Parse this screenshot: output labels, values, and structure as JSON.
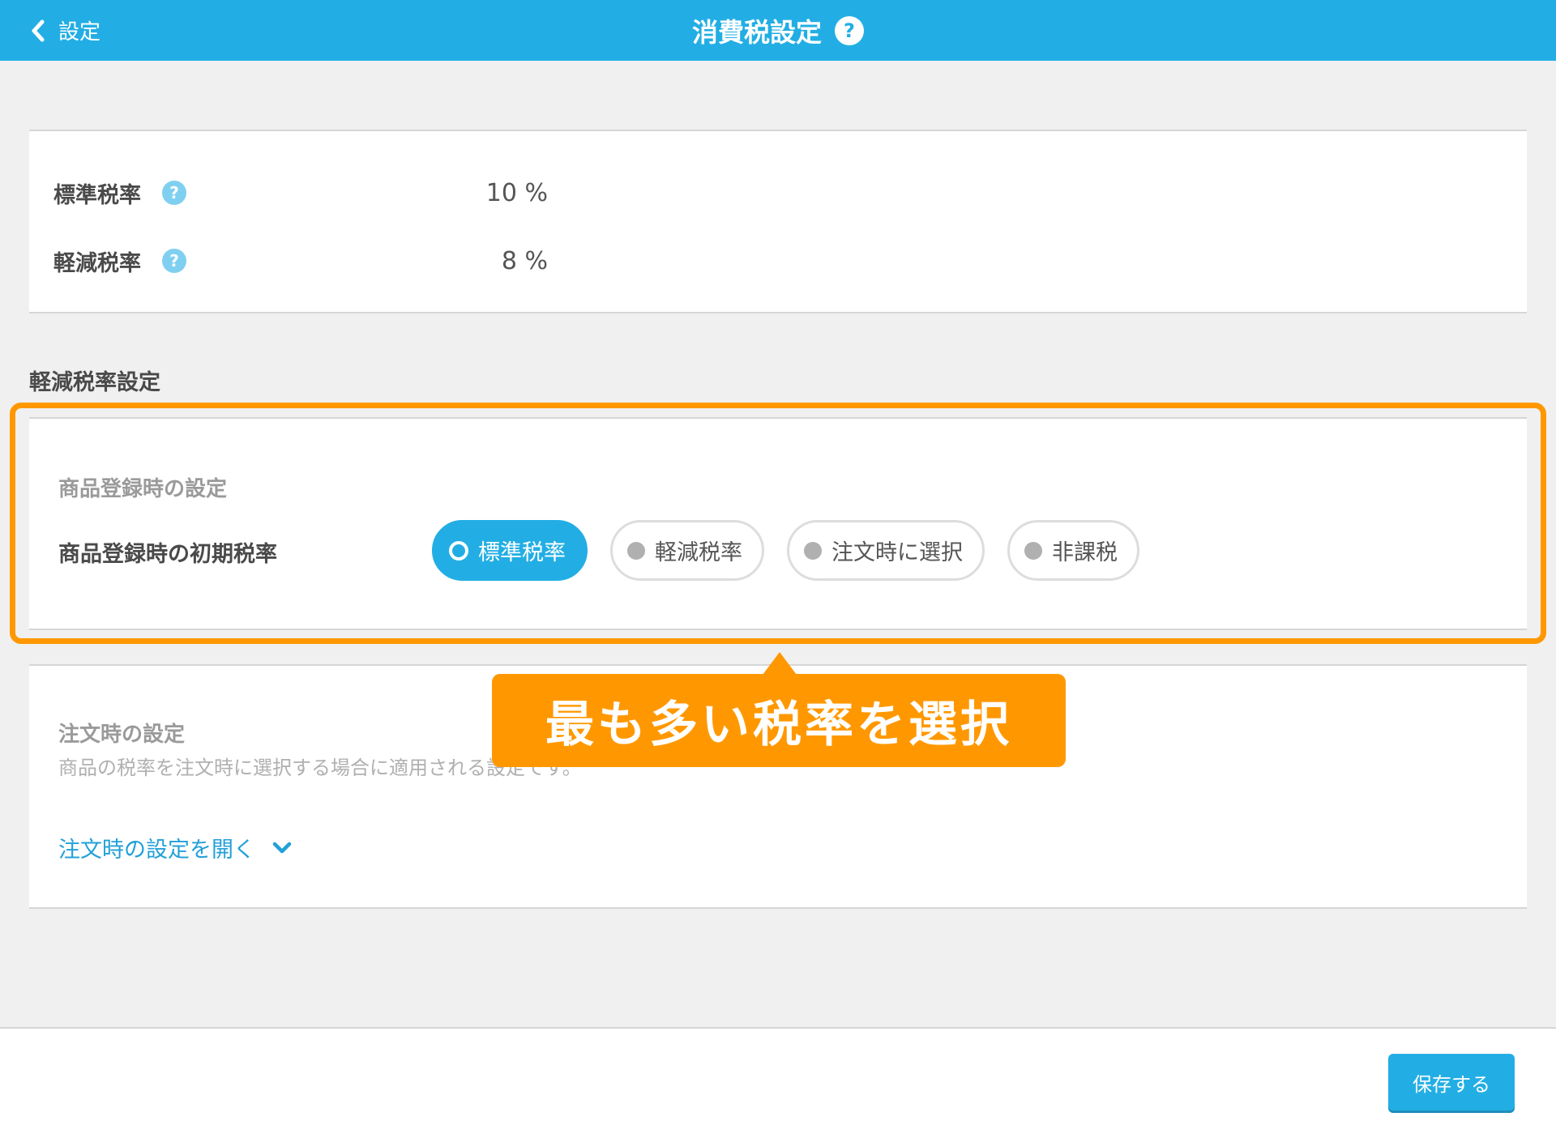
{
  "header": {
    "back_label": "設定",
    "title": "消費税設定",
    "help_glyph": "?"
  },
  "rates": [
    {
      "label": "標準税率",
      "help_glyph": "?",
      "value": "10 %"
    },
    {
      "label": "軽減税率",
      "help_glyph": "?",
      "value": "8 %"
    }
  ],
  "reduced_section": {
    "heading": "軽減税率設定",
    "product": {
      "heading": "商品登録時の設定",
      "field_label": "商品登録時の初期税率",
      "options": [
        "標準税率",
        "軽減税率",
        "注文時に選択",
        "非課税"
      ],
      "selected": "標準税率"
    },
    "order": {
      "heading": "注文時の設定",
      "description": "商品の税率を注文時に選択する場合に適用される設定です。",
      "open_label": "注文時の設定を開く"
    }
  },
  "tooltip": {
    "text": "最も多い税率を選択"
  },
  "footer": {
    "save_label": "保存する"
  },
  "colors": {
    "header": "#22aee4",
    "accent_highlight": "#ff9800",
    "help_icon": "#7fd0f0",
    "link": "#22a0d8"
  },
  "icons": {
    "back": "chevron-left-icon",
    "help": "question-circle-icon",
    "expand": "chevron-down-icon",
    "radio_selected": "radio-ring-icon",
    "radio_unselected": "radio-dot-icon"
  }
}
